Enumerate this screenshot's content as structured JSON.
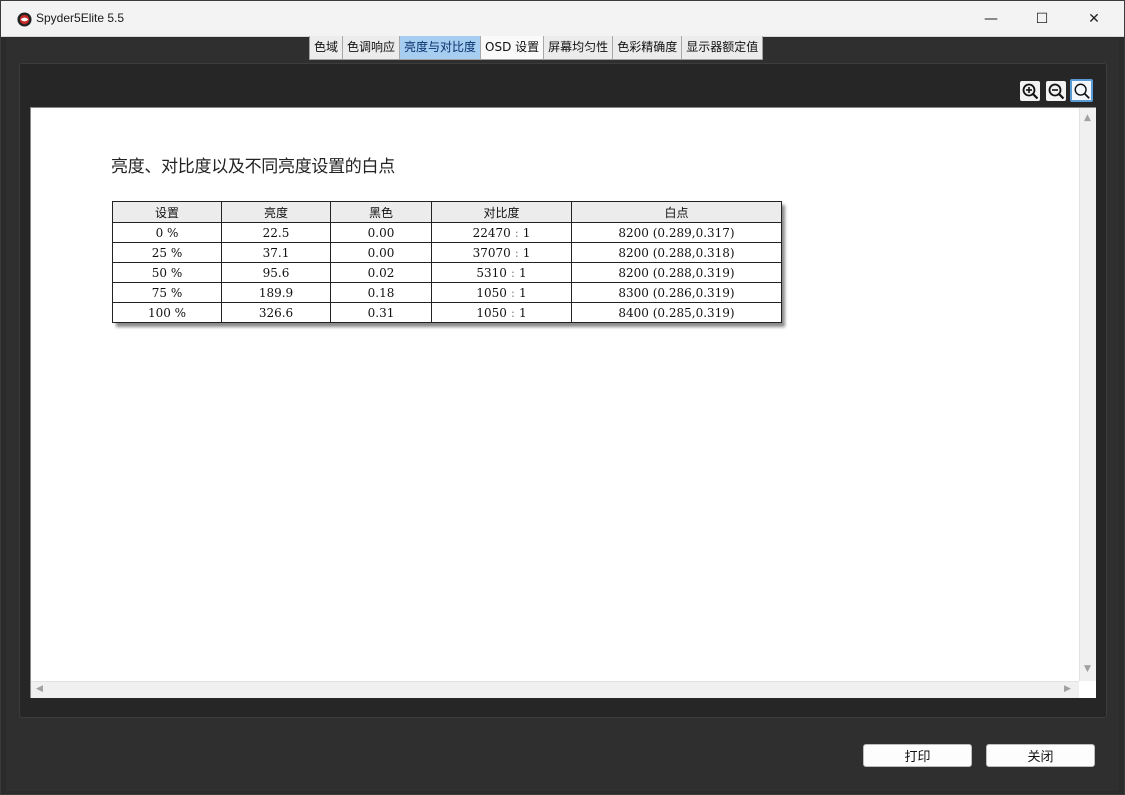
{
  "window": {
    "title": "Spyder5Elite 5.5",
    "minimize_glyph": "—",
    "maximize_glyph": "☐",
    "close_glyph": "✕"
  },
  "tabs": [
    {
      "label": "色域"
    },
    {
      "label": "色调响应"
    },
    {
      "label": "亮度与对比度",
      "active": true
    },
    {
      "label": "OSD 设置"
    },
    {
      "label": "屏幕均匀性"
    },
    {
      "label": "色彩精确度"
    },
    {
      "label": "显示器额定值"
    }
  ],
  "toolbar": {
    "icons": [
      "zoom-in-icon",
      "zoom-out-icon",
      "zoom-fit-icon"
    ]
  },
  "report": {
    "title": "亮度、对比度以及不同亮度设置的白点",
    "table": {
      "headers": [
        "设置",
        "亮度",
        "黑色",
        "对比度",
        "白点"
      ],
      "rows": [
        {
          "setting": "0 %",
          "luminance": "22.5",
          "black": "0.00",
          "contrast_a": "22470",
          "contrast_sep": ":",
          "contrast_b": "1",
          "whitepoint": "8200 (0.289,0.317)"
        },
        {
          "setting": "25 %",
          "luminance": "37.1",
          "black": "0.00",
          "contrast_a": "37070",
          "contrast_sep": ":",
          "contrast_b": "1",
          "whitepoint": "8200 (0.288,0.318)"
        },
        {
          "setting": "50 %",
          "luminance": "95.6",
          "black": "0.02",
          "contrast_a": "5310",
          "contrast_sep": ":",
          "contrast_b": "1",
          "whitepoint": "8200 (0.288,0.319)"
        },
        {
          "setting": "75 %",
          "luminance": "189.9",
          "black": "0.18",
          "contrast_a": "1050",
          "contrast_sep": ":",
          "contrast_b": "1",
          "whitepoint": "8300 (0.286,0.319)"
        },
        {
          "setting": "100 %",
          "luminance": "326.6",
          "black": "0.31",
          "contrast_a": "1050",
          "contrast_sep": ":",
          "contrast_b": "1",
          "whitepoint": "8400 (0.285,0.319)"
        }
      ]
    }
  },
  "buttons": {
    "print": "打印",
    "close": "关闭"
  },
  "colors": {
    "active_tab": "#a7cdf0",
    "window_bg": "#2f2f2f"
  }
}
